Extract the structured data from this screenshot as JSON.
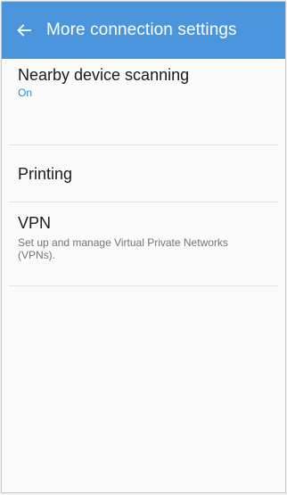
{
  "colors": {
    "app_bar": "#4b95dc",
    "accent": "#2a8fd0",
    "background": "#fafafa"
  },
  "header": {
    "back_icon": "arrow-left-icon",
    "title": "More connection settings"
  },
  "items": [
    {
      "title": "Nearby device scanning",
      "status": "On"
    },
    {
      "title": "Printing"
    },
    {
      "title": "VPN",
      "description": "Set up and manage Virtual Private Networks (VPNs)."
    }
  ]
}
